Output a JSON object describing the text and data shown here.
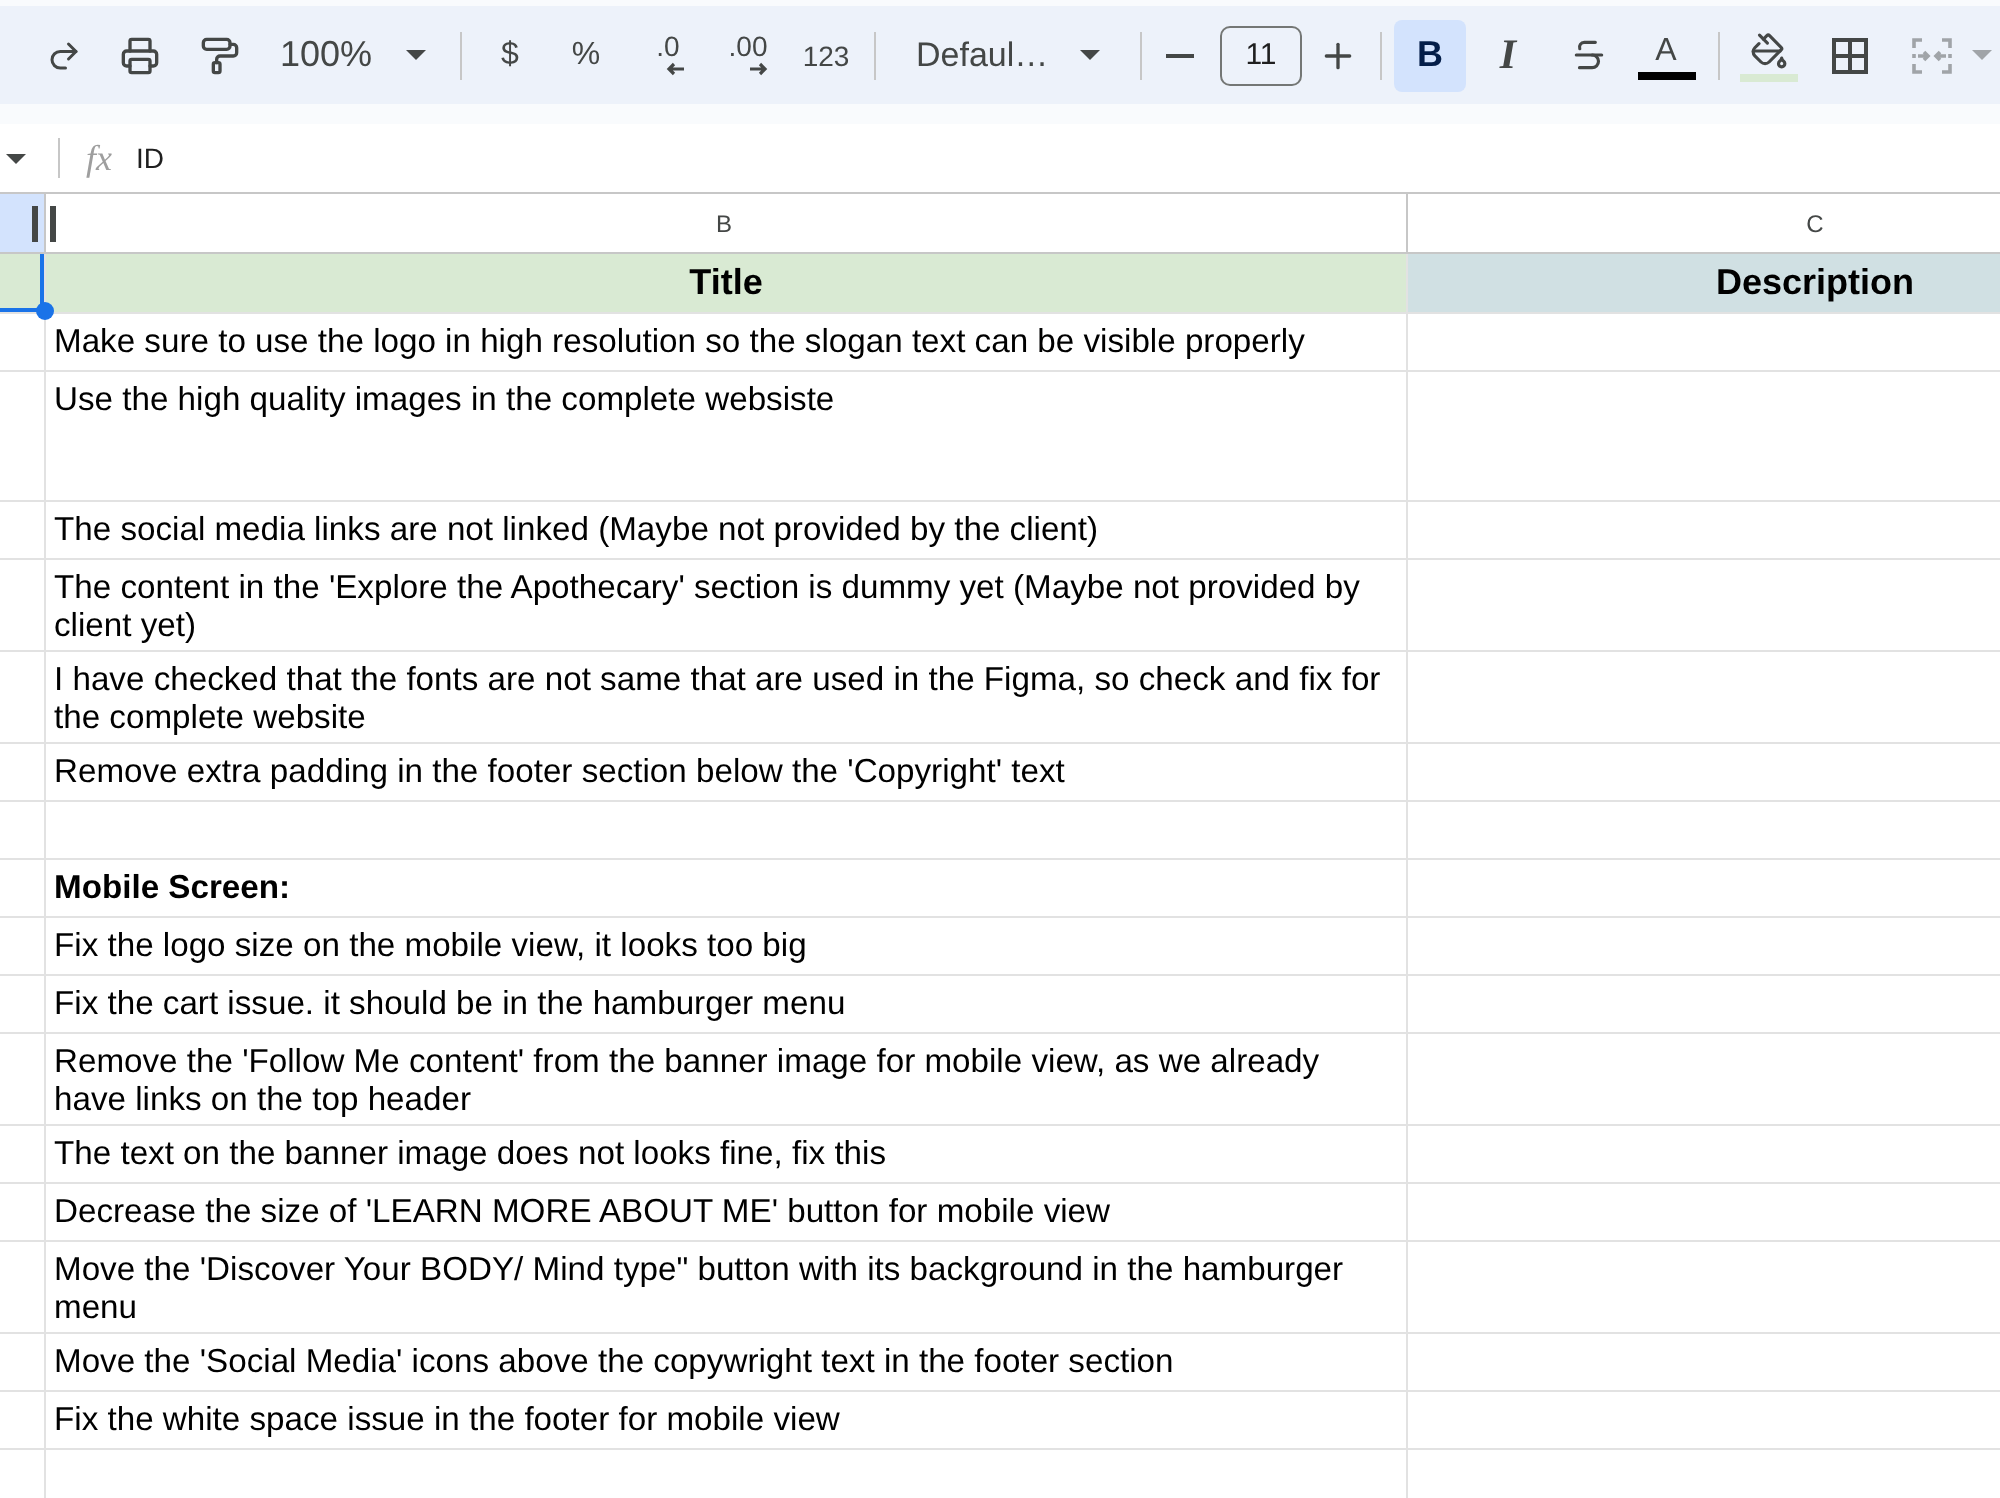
{
  "toolbar": {
    "zoom": "100%",
    "currency": "$",
    "percent": "%",
    "decrease_decimals": ".0",
    "increase_decimals": ".00",
    "number_format": "123",
    "font": "Defaul…",
    "font_size": "11",
    "bold": {
      "label": "B",
      "on": true
    },
    "italic": {
      "label": "I",
      "on": false
    },
    "strikethrough": {
      "on": false
    },
    "text_color": {
      "label": "A",
      "color": "#000000"
    },
    "fill_color": {
      "color": "#d9ead3"
    },
    "merge": {
      "disabled": true
    }
  },
  "formula_bar": {
    "function_label": "fx",
    "value": "ID"
  },
  "columns": [
    {
      "selected": true
    },
    {
      "letter": "B",
      "selected": false
    },
    {
      "letter": "C",
      "selected": false
    }
  ],
  "header_row": [
    {
      "color": "#d9ead3",
      "selected": true
    },
    {
      "text": "Title",
      "color": "#d9ead3",
      "selected": false
    },
    {
      "text": "Description",
      "color": "#d0e0e3",
      "selected": false
    }
  ],
  "rows": [
    {
      "kind": "text",
      "title": "Make sure to use the logo in high resolution so the slogan text can be visible properly",
      "bold": false
    },
    {
      "kind": "text",
      "title": "Use the high quality images in the complete websiste",
      "bold": false
    },
    {
      "kind": "text",
      "title": "The social media links are not linked (Maybe not provided by the client)",
      "bold": false
    },
    {
      "kind": "text",
      "title": "The content in the 'Explore the Apothecary' section is dummy yet (Maybe not provided by client yet)",
      "bold": false
    },
    {
      "kind": "text",
      "title": "I have checked that the fonts are not same that are used in the Figma, so check and fix for the complete website",
      "bold": false
    },
    {
      "kind": "text",
      "title": "Remove extra padding in the footer section below the 'Copyright' text",
      "bold": false
    },
    {
      "kind": "blank"
    },
    {
      "kind": "text",
      "title": "Mobile Screen:",
      "bold": true
    },
    {
      "kind": "text",
      "title": "Fix the logo size on the mobile view, it looks too big",
      "bold": false
    },
    {
      "kind": "text",
      "title": "Fix the cart issue. it should be in the hamburger menu",
      "bold": false
    },
    {
      "kind": "text",
      "title": "Remove the 'Follow Me content' from the banner image for mobile view, as we already have links on the top header",
      "bold": false
    },
    {
      "kind": "text",
      "title": "The text on the banner image does not looks fine, fix this",
      "bold": false
    },
    {
      "kind": "text",
      "title": "Decrease the size of 'LEARN MORE ABOUT ME' button for mobile view",
      "bold": false
    },
    {
      "kind": "text",
      "title": "Move the 'Discover Your BODY/ Mind type\" button with its background in the hamburger menu",
      "bold": false
    },
    {
      "kind": "text",
      "title": "Move the 'Social Media' icons above the copywright text in the footer section",
      "bold": false
    },
    {
      "kind": "text",
      "title": "Fix the white space issue in the footer for mobile view",
      "bold": false
    },
    {
      "kind": "blank"
    }
  ]
}
